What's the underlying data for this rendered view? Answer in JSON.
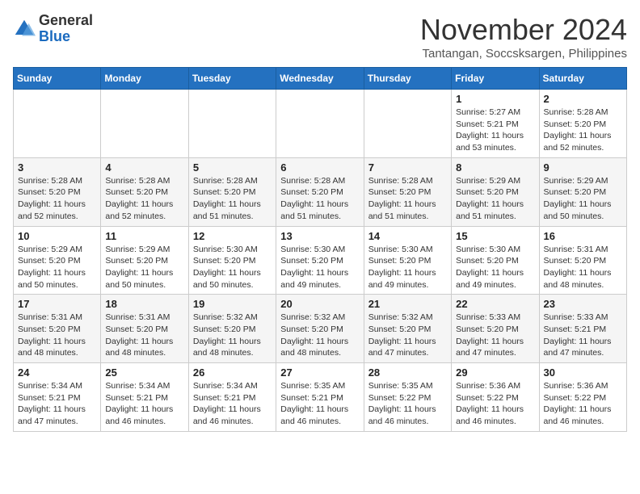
{
  "header": {
    "logo_line1": "General",
    "logo_line2": "Blue",
    "month_title": "November 2024",
    "location": "Tantangan, Soccsksargen, Philippines"
  },
  "weekdays": [
    "Sunday",
    "Monday",
    "Tuesday",
    "Wednesday",
    "Thursday",
    "Friday",
    "Saturday"
  ],
  "weeks": [
    [
      {
        "day": "",
        "info": ""
      },
      {
        "day": "",
        "info": ""
      },
      {
        "day": "",
        "info": ""
      },
      {
        "day": "",
        "info": ""
      },
      {
        "day": "",
        "info": ""
      },
      {
        "day": "1",
        "info": "Sunrise: 5:27 AM\nSunset: 5:21 PM\nDaylight: 11 hours and 53 minutes."
      },
      {
        "day": "2",
        "info": "Sunrise: 5:28 AM\nSunset: 5:20 PM\nDaylight: 11 hours and 52 minutes."
      }
    ],
    [
      {
        "day": "3",
        "info": "Sunrise: 5:28 AM\nSunset: 5:20 PM\nDaylight: 11 hours and 52 minutes."
      },
      {
        "day": "4",
        "info": "Sunrise: 5:28 AM\nSunset: 5:20 PM\nDaylight: 11 hours and 52 minutes."
      },
      {
        "day": "5",
        "info": "Sunrise: 5:28 AM\nSunset: 5:20 PM\nDaylight: 11 hours and 51 minutes."
      },
      {
        "day": "6",
        "info": "Sunrise: 5:28 AM\nSunset: 5:20 PM\nDaylight: 11 hours and 51 minutes."
      },
      {
        "day": "7",
        "info": "Sunrise: 5:28 AM\nSunset: 5:20 PM\nDaylight: 11 hours and 51 minutes."
      },
      {
        "day": "8",
        "info": "Sunrise: 5:29 AM\nSunset: 5:20 PM\nDaylight: 11 hours and 51 minutes."
      },
      {
        "day": "9",
        "info": "Sunrise: 5:29 AM\nSunset: 5:20 PM\nDaylight: 11 hours and 50 minutes."
      }
    ],
    [
      {
        "day": "10",
        "info": "Sunrise: 5:29 AM\nSunset: 5:20 PM\nDaylight: 11 hours and 50 minutes."
      },
      {
        "day": "11",
        "info": "Sunrise: 5:29 AM\nSunset: 5:20 PM\nDaylight: 11 hours and 50 minutes."
      },
      {
        "day": "12",
        "info": "Sunrise: 5:30 AM\nSunset: 5:20 PM\nDaylight: 11 hours and 50 minutes."
      },
      {
        "day": "13",
        "info": "Sunrise: 5:30 AM\nSunset: 5:20 PM\nDaylight: 11 hours and 49 minutes."
      },
      {
        "day": "14",
        "info": "Sunrise: 5:30 AM\nSunset: 5:20 PM\nDaylight: 11 hours and 49 minutes."
      },
      {
        "day": "15",
        "info": "Sunrise: 5:30 AM\nSunset: 5:20 PM\nDaylight: 11 hours and 49 minutes."
      },
      {
        "day": "16",
        "info": "Sunrise: 5:31 AM\nSunset: 5:20 PM\nDaylight: 11 hours and 48 minutes."
      }
    ],
    [
      {
        "day": "17",
        "info": "Sunrise: 5:31 AM\nSunset: 5:20 PM\nDaylight: 11 hours and 48 minutes."
      },
      {
        "day": "18",
        "info": "Sunrise: 5:31 AM\nSunset: 5:20 PM\nDaylight: 11 hours and 48 minutes."
      },
      {
        "day": "19",
        "info": "Sunrise: 5:32 AM\nSunset: 5:20 PM\nDaylight: 11 hours and 48 minutes."
      },
      {
        "day": "20",
        "info": "Sunrise: 5:32 AM\nSunset: 5:20 PM\nDaylight: 11 hours and 48 minutes."
      },
      {
        "day": "21",
        "info": "Sunrise: 5:32 AM\nSunset: 5:20 PM\nDaylight: 11 hours and 47 minutes."
      },
      {
        "day": "22",
        "info": "Sunrise: 5:33 AM\nSunset: 5:20 PM\nDaylight: 11 hours and 47 minutes."
      },
      {
        "day": "23",
        "info": "Sunrise: 5:33 AM\nSunset: 5:21 PM\nDaylight: 11 hours and 47 minutes."
      }
    ],
    [
      {
        "day": "24",
        "info": "Sunrise: 5:34 AM\nSunset: 5:21 PM\nDaylight: 11 hours and 47 minutes."
      },
      {
        "day": "25",
        "info": "Sunrise: 5:34 AM\nSunset: 5:21 PM\nDaylight: 11 hours and 46 minutes."
      },
      {
        "day": "26",
        "info": "Sunrise: 5:34 AM\nSunset: 5:21 PM\nDaylight: 11 hours and 46 minutes."
      },
      {
        "day": "27",
        "info": "Sunrise: 5:35 AM\nSunset: 5:21 PM\nDaylight: 11 hours and 46 minutes."
      },
      {
        "day": "28",
        "info": "Sunrise: 5:35 AM\nSunset: 5:22 PM\nDaylight: 11 hours and 46 minutes."
      },
      {
        "day": "29",
        "info": "Sunrise: 5:36 AM\nSunset: 5:22 PM\nDaylight: 11 hours and 46 minutes."
      },
      {
        "day": "30",
        "info": "Sunrise: 5:36 AM\nSunset: 5:22 PM\nDaylight: 11 hours and 46 minutes."
      }
    ]
  ]
}
